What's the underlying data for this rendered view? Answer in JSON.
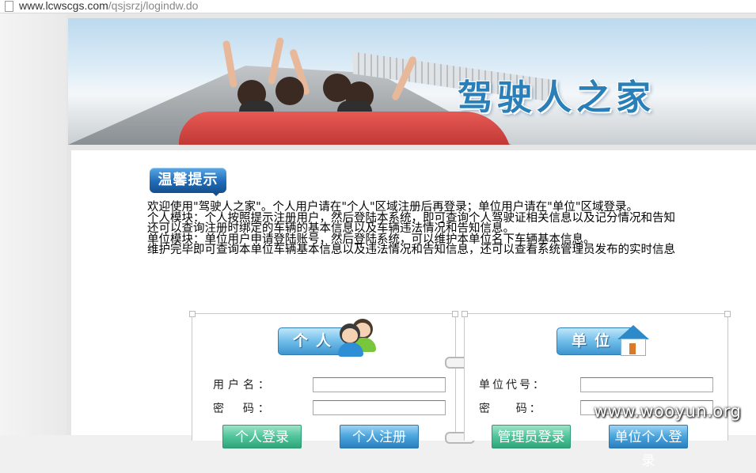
{
  "address_bar": {
    "url_host": "www.lcwscgs.com",
    "url_path": "/qsjsrzj/logindw.do"
  },
  "banner": {
    "title": "驾驶人之家"
  },
  "tip": {
    "label": "温馨提示"
  },
  "intro_lines": [
    "欢迎使用\"驾驶人之家\"。个人用户请在\"个人\"区域注册后再登录；单位用户请在\"单位\"区域登录。",
    "个人模块：个人按照提示注册用户，然后登陆本系统，即可查询个人驾驶证相关信息以及记分情况和告知",
    "还可以查询注册时绑定的车辆的基本信息以及车辆违法情况和告知信息。",
    "单位模块：单位用户申请登陆账号，然后登陆系统，可以维护本单位名下车辆基本信息。",
    "维护完毕即可查询本单位车辆基本信息以及违法情况和告知信息，还可以查看系统管理员发布的实时信息"
  ],
  "personal": {
    "title": "个人",
    "username_label": "用户名：",
    "password_label": "密  码：",
    "username_value": "",
    "password_value": "",
    "login_button": "个人登录",
    "register_button": "个人注册"
  },
  "unit": {
    "title": "单位",
    "code_label": "单位代号：",
    "password_label": "密    码：",
    "code_value": "",
    "password_value": "",
    "admin_button": "管理员登录",
    "login_button": "单位个人登录"
  },
  "watermark": "www.wooyun.org",
  "colors": {
    "title_blue": "#2a7fb8",
    "green_button": "#55c79e",
    "blue_button": "#4ea7de"
  }
}
